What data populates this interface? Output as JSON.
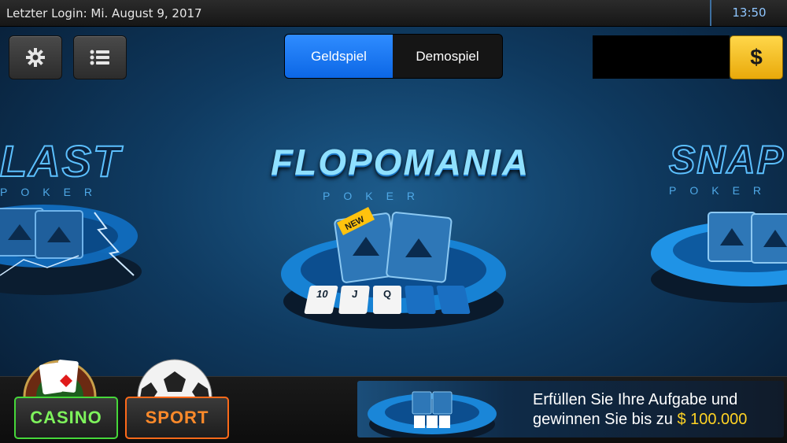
{
  "topbar": {
    "login_text": "Letzter Login: Mi. August 9, 2017",
    "time": "13:50"
  },
  "toolbar": {
    "settings_icon": "gear-icon",
    "menu_icon": "list-icon",
    "mode_active": "Geldspiel",
    "mode_inactive": "Demospiel",
    "cashier_label": "$"
  },
  "games": {
    "left": {
      "title": "LAST",
      "subtitle": "POKER"
    },
    "center": {
      "title": "FLOPOMANIA",
      "subtitle": "POKER",
      "badge": "NEW",
      "cards": [
        "10",
        "J",
        "Q"
      ]
    },
    "right": {
      "title": "SNAP",
      "subtitle": "POKER"
    }
  },
  "bottom": {
    "casino_label": "CASINO",
    "sport_label": "SPORT",
    "banner_line1": "Erfüllen Sie Ihre Aufgabe und",
    "banner_line2": "gewinnen Sie bis zu",
    "banner_prize": "$ 100.000"
  },
  "colors": {
    "accent": "#0c67e6",
    "casino": "#46d73a",
    "sport": "#ff6a1a",
    "prize": "#ffd324"
  }
}
